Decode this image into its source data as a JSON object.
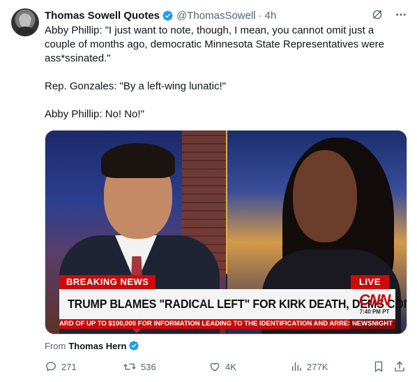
{
  "author": {
    "name": "Thomas Sowell Quotes",
    "handle": "@ThomasSowell",
    "separator": "·",
    "time": "4h",
    "verified": true
  },
  "tweet": {
    "paragraphs": [
      "Abby Phillip: \"I just want to note, though, I mean, you cannot omit just a couple of months ago, democratic Minnesota State Representatives were ass*ssinated.\"",
      "Rep. Gonzales: \"By a left-wing lunatic!\"",
      "Abby Phillip: No! No!\""
    ]
  },
  "media": {
    "breaking_label": "BREAKING NEWS",
    "live_label": "LIVE",
    "headline": "TRUMP BLAMES \"RADICAL LEFT\" FOR KIRK DEATH, DEMS CONDEMN",
    "network_logo": "CNN",
    "broadcast_time": "7:40 PM PT",
    "ticker_text": "ARD OF UP TO $100,000 FOR INFORMATION LEADING TO THE IDENTIFICATION AND ARRES",
    "ticker_tag": "NEWSNIGHT"
  },
  "attribution": {
    "prefix": "From",
    "source_name": "Thomas Hern",
    "verified": true
  },
  "actions": {
    "replies": "271",
    "reposts": "536",
    "likes": "4K",
    "views": "277K"
  },
  "colors": {
    "text_primary": "#0f1419",
    "text_secondary": "#536471",
    "verified_blue": "#1d9bf0",
    "cnn_red": "#cc0a0a"
  },
  "icons": [
    "grok-icon",
    "more-icon",
    "verified-badge-icon",
    "reply-icon",
    "repost-icon",
    "like-icon",
    "views-icon",
    "bookmark-icon",
    "share-icon"
  ]
}
